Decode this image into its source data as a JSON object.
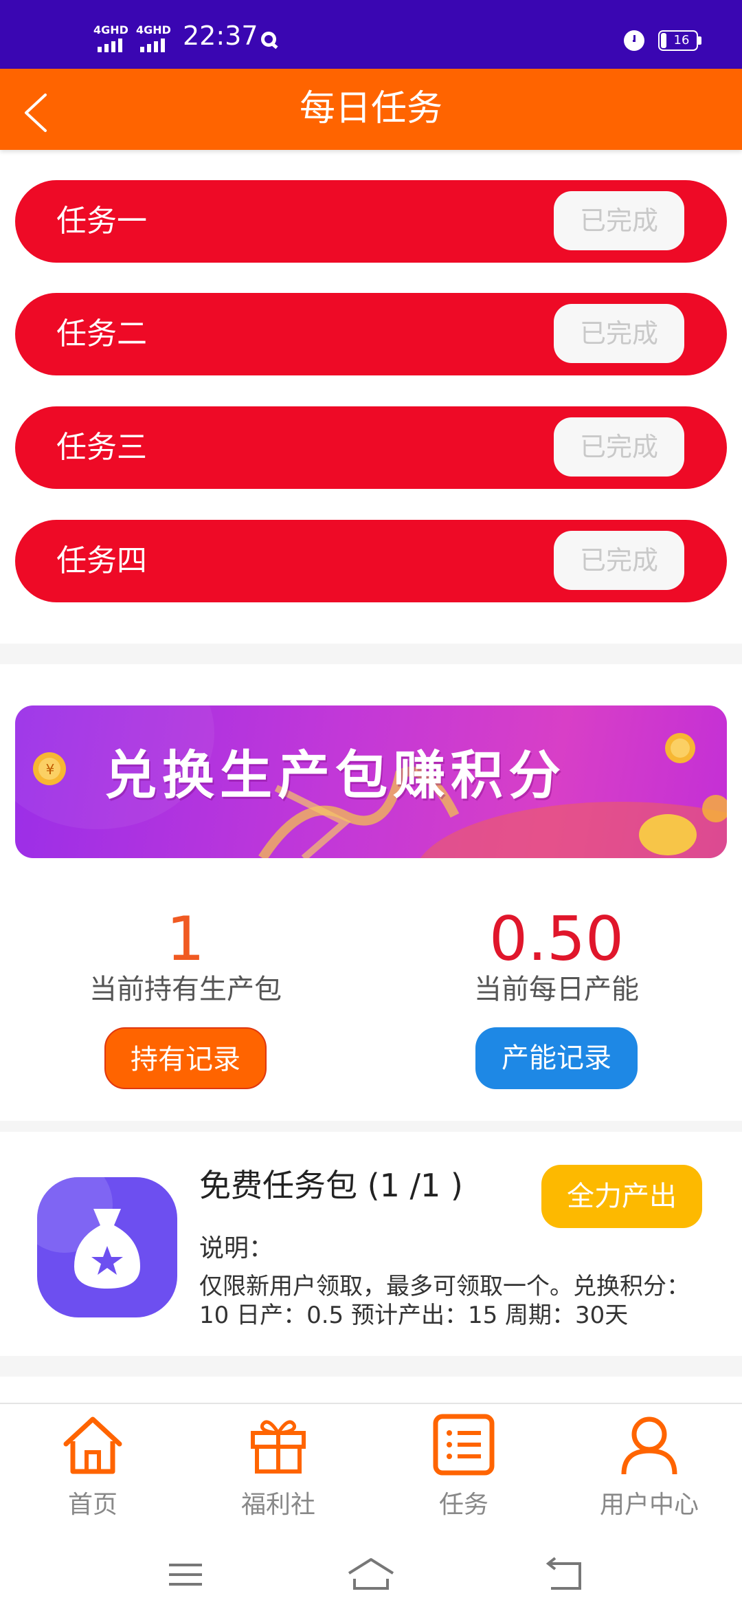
{
  "status_bar": {
    "signal_1": "4GHD",
    "signal_2": "4GHD",
    "time": "22:37",
    "battery": "16"
  },
  "header": {
    "title": "每日任务"
  },
  "tasks": [
    {
      "label": "任务一",
      "status": "已完成"
    },
    {
      "label": "任务二",
      "status": "已完成"
    },
    {
      "label": "任务三",
      "status": "已完成"
    },
    {
      "label": "任务四",
      "status": "已完成"
    }
  ],
  "banner": {
    "text": "兑换生产包赚积分"
  },
  "stats": {
    "held": {
      "value": "1",
      "label": "当前持有生产包",
      "button": "持有记录"
    },
    "capacity": {
      "value": "0.50",
      "label": "当前每日产能",
      "button": "产能记录"
    }
  },
  "package": {
    "title": "免费任务包 (1 /1 )",
    "button": "全力产出",
    "desc_title": "说明：",
    "desc": "仅限新用户领取，最多可领取一个。兑换积分：10 日产：0.5 预计产出：15 周期：30天"
  },
  "tabs": [
    {
      "label": "首页"
    },
    {
      "label": "福利社"
    },
    {
      "label": "任务"
    },
    {
      "label": "用户中心"
    }
  ],
  "colors": {
    "status_bar": "#3a06b2",
    "header": "#ff6400",
    "task_row": "#ee0a26",
    "held_value": "#f05a22",
    "capacity_value": "#e0162b",
    "held_button": "#ff6400",
    "capacity_button": "#1e88e5",
    "package_button": "#fdb900",
    "tab_icon": "#ff6400"
  }
}
